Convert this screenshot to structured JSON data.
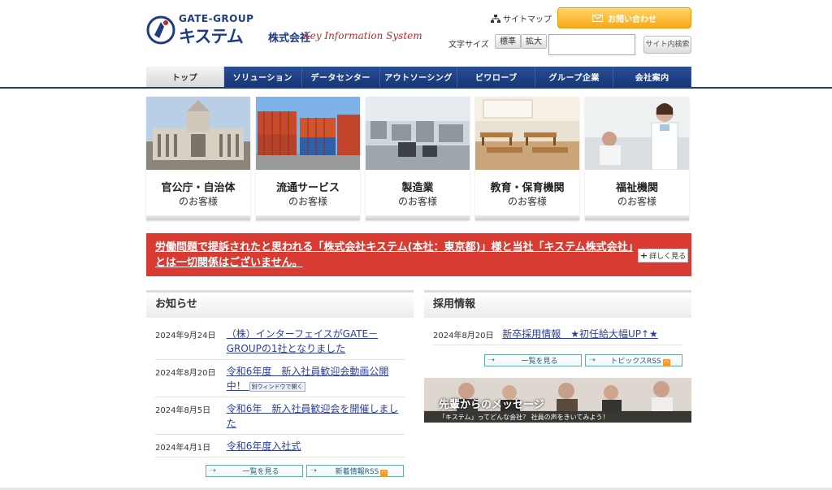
{
  "header": {
    "logo_gate": "GATE-GROUP",
    "logo_kistem": "キステム",
    "logo_kaisha": "株式会社",
    "logo_tagline": "Key Information System",
    "sitemap_label": "サイトマップ",
    "contact_label": "お問い合わせ",
    "fontsize_label": "文字サイズ",
    "fontsize_standard": "標準",
    "fontsize_large": "拡大",
    "search_placeholder": "",
    "search_button": "サイト内検索"
  },
  "nav": {
    "items": [
      "トップ",
      "ソリューション",
      "データセンター",
      "アウトソーシング",
      "ビワローブ",
      "グループ企業",
      "会社案内"
    ]
  },
  "cards": [
    {
      "title": "官公庁・自治体",
      "sub": "のお客様"
    },
    {
      "title": "流通サービス",
      "sub": "のお客様"
    },
    {
      "title": "製造業",
      "sub": "のお客様"
    },
    {
      "title": "教育・保育機関",
      "sub": "のお客様"
    },
    {
      "title": "福祉機関",
      "sub": "のお客様"
    }
  ],
  "notice": {
    "text": "労働問題で提訴されたと思われる「株式会社キステム(本社：東京都)」様と当社「キステム株式会社」とは一切関係はございません。",
    "button": "詳しく見る"
  },
  "news": {
    "heading": "お知らせ",
    "items": [
      {
        "date": "2024年9月24日",
        "title": "（株）インターフェイスがGATE－GROUPの1社となりました"
      },
      {
        "date": "2024年8月20日",
        "title": "令和6年度　新入社員歓迎会動画公開中！",
        "badge": "別ウィンドウで開く"
      },
      {
        "date": "2024年8月5日",
        "title": "令和6年　新入社員歓迎会を開催しました"
      },
      {
        "date": "2024年4月1日",
        "title": "令和6年度入社式"
      }
    ],
    "list_button": "一覧を見る",
    "rss_button": "新着情報RSS"
  },
  "recruit": {
    "heading": "採用情報",
    "items": [
      {
        "date": "2024年8月20日",
        "title": "新卒採用情報　★初任給大幅UP↑★"
      }
    ],
    "list_button": "一覧を見る",
    "rss_button": "トピックスRSS"
  },
  "banner": {
    "title": "先輩からのメッセージ",
    "sub": "「キステム」ってどんな会社？ 社員の声をきいてみよう！"
  },
  "colors": {
    "nav_blue": "#1f3c80",
    "notice_red": "#d83b32",
    "contact_orange": "#f7a718",
    "link_blue": "#2d3f9b"
  }
}
